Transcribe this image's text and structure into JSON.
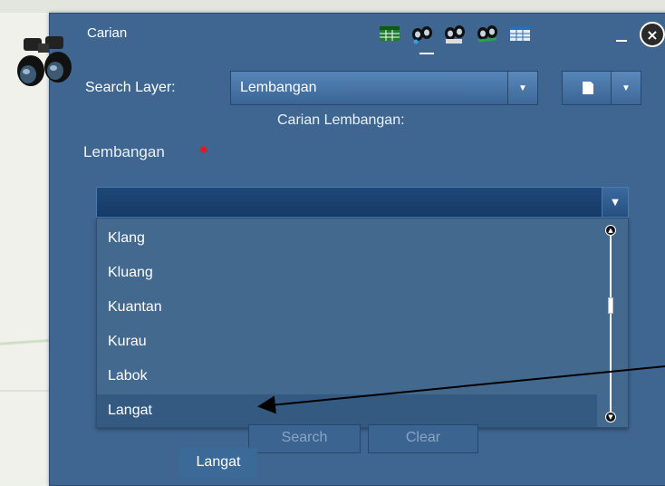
{
  "panel": {
    "title": "Carian",
    "search_layer_label": "Search Layer:",
    "search_layer_value": "Lembangan",
    "form_title": "Carian Lembangan:",
    "field_label": "Lembangan",
    "required_marker": "*",
    "toolbar_icons": [
      "table-icon",
      "binoculars-pin-icon",
      "binoculars-query-icon",
      "binoculars-buffer-icon",
      "grid-icon"
    ],
    "minimize_icon": "minimize-icon",
    "close_label": "×"
  },
  "dropdown": {
    "items": [
      "Klang",
      "Kluang",
      "Kuantan",
      "Kurau",
      "Labok",
      "Langat"
    ],
    "selected": "Langat"
  },
  "buttons": {
    "search": "Search",
    "clear": "Clear"
  },
  "tab_chip": "Langat",
  "colors": {
    "panel_bg": "#3f6690",
    "dropdown_bg": "#44698f",
    "selected_bg": "#345a82",
    "required": "#e11111"
  }
}
